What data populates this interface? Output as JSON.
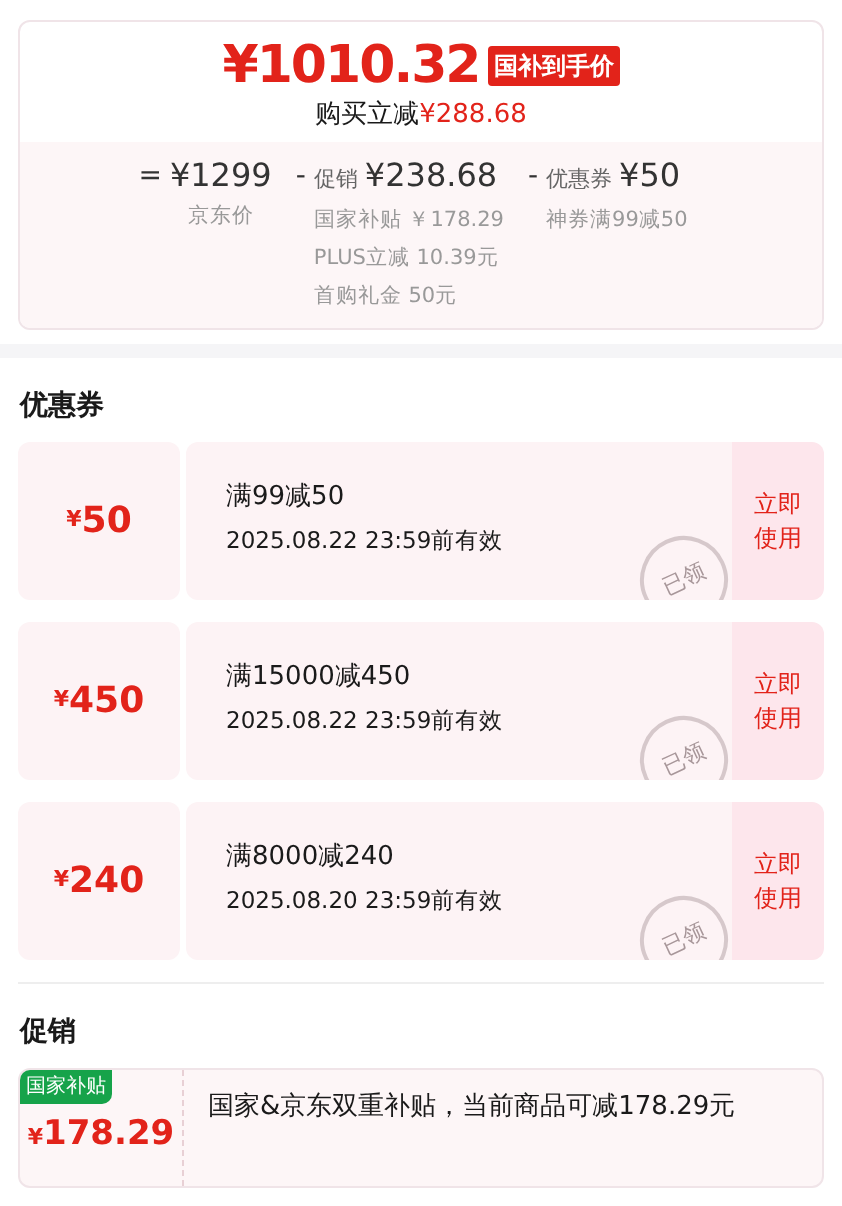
{
  "price_card": {
    "final_price": "¥1010.32",
    "price_tag": "国补到手价",
    "saving_label": "购买立减",
    "saving_amount": "¥288.68",
    "breakdown": [
      {
        "operator": "=",
        "amount": "¥1299",
        "sub": [
          "京东价"
        ]
      },
      {
        "operator": "-",
        "label": "促销",
        "amount": "¥238.68",
        "sub": [
          "国家补贴 ￥178.29",
          "PLUS立减 10.39元",
          "首购礼金 50元"
        ]
      },
      {
        "operator": "-",
        "label": "优惠券",
        "amount": "¥50",
        "sub": [
          "神券满99减50"
        ]
      }
    ]
  },
  "coupons_section": {
    "title": "优惠券",
    "coupons": [
      {
        "currency": "¥",
        "amount": "50",
        "condition": "满99减50",
        "validity": "2025.08.22 23:59前有效",
        "stamp": "已领",
        "action": "立即使用"
      },
      {
        "currency": "¥",
        "amount": "450",
        "condition": "满15000减450",
        "validity": "2025.08.22 23:59前有效",
        "stamp": "已领",
        "action": "立即使用"
      },
      {
        "currency": "¥",
        "amount": "240",
        "condition": "满8000减240",
        "validity": "2025.08.20 23:59前有效",
        "stamp": "已领",
        "action": "立即使用"
      }
    ]
  },
  "promotions_section": {
    "title": "促销",
    "promotions": [
      {
        "tag": "国家补贴",
        "currency": "¥",
        "amount": "178.29",
        "description": "国家&京东双重补贴，当前商品可减178.29元"
      }
    ]
  }
}
